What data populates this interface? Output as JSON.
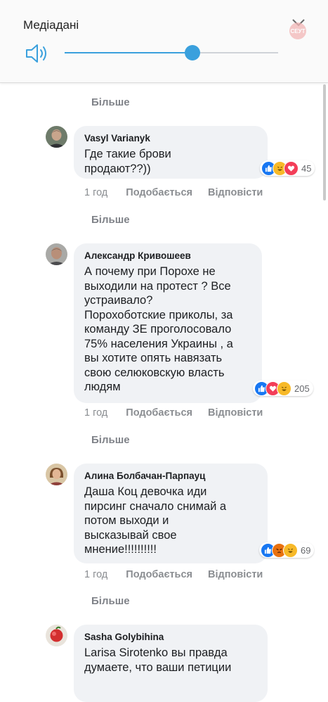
{
  "media_panel": {
    "title": "Медіадані",
    "watermark": "СЕУТ",
    "volume_level": 0.6
  },
  "comments": [
    {
      "more_label": "Більше",
      "author": "Vasyl Varianyk",
      "text": "Где такие брови\nпродают??))",
      "reactions": [
        "like",
        "haha",
        "love"
      ],
      "reaction_count": "45",
      "time": "1 год",
      "like_label": "Подобається",
      "reply_label": "Відповісти"
    },
    {
      "more_label": "Більше",
      "author": "Александр Кривошеев",
      "text": "А почему при Порохе не\nвыходили на протест ? Все\nустраивало?\nПорохоботские приколы, за\nкоманду ЗЕ проголосовало\n75% населения Украины , а\nвы хотите опять навязать\nсвою селюковскую власть\nлюдям",
      "reactions": [
        "like",
        "love",
        "haha"
      ],
      "reaction_count": "205",
      "time": "1 год",
      "like_label": "Подобається",
      "reply_label": "Відповісти"
    },
    {
      "more_label": "Більше",
      "author": "Алина Болбачан-Парпауц",
      "text": "Даша Коц девочка иди\nпирсинг сначало снимай а\nпотом выходи и\nвысказывай свое\nмнение!!!!!!!!!!",
      "reactions": [
        "like",
        "angry",
        "haha"
      ],
      "reaction_count": "69",
      "time": "1 год",
      "like_label": "Подобається",
      "reply_label": "Відповісти"
    },
    {
      "more_label": "Більше",
      "author": "Sasha Golybihina",
      "text": "Larisa Sirotenko вы правда\nдумаете, что ваши петиции"
    }
  ]
}
